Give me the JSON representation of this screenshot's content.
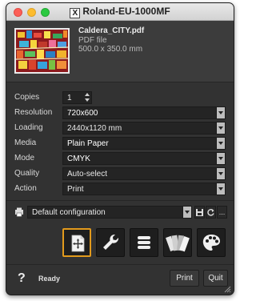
{
  "window": {
    "title": "Roland-EU-1000MF",
    "logo": "X"
  },
  "file": {
    "name": "Caldera_CITY.pdf",
    "type": "PDF file",
    "size": "500.0 x 350.0 mm"
  },
  "settings": {
    "copies": {
      "label": "Copies",
      "value": "1"
    },
    "resolution": {
      "label": "Resolution",
      "value": "720x600"
    },
    "loading": {
      "label": "Loading",
      "value": "2440x1120 mm"
    },
    "media": {
      "label": "Media",
      "value": "Plain Paper"
    },
    "mode": {
      "label": "Mode",
      "value": "CMYK"
    },
    "quality": {
      "label": "Quality",
      "value": "Auto-select"
    },
    "action": {
      "label": "Action",
      "value": "Print"
    }
  },
  "config": {
    "value": "Default configuration",
    "more_label": "..."
  },
  "toolbar": {
    "icons": [
      "layout-move-icon",
      "wrench-icon",
      "list-icon",
      "color-swatch-icon",
      "palette-icon"
    ]
  },
  "status": {
    "help": "?",
    "text": "Ready",
    "print_label": "Print",
    "quit_label": "Quit"
  },
  "colors": {
    "window_bg": "#323232",
    "field_bg": "#242424",
    "accent": "#e29a1c"
  }
}
